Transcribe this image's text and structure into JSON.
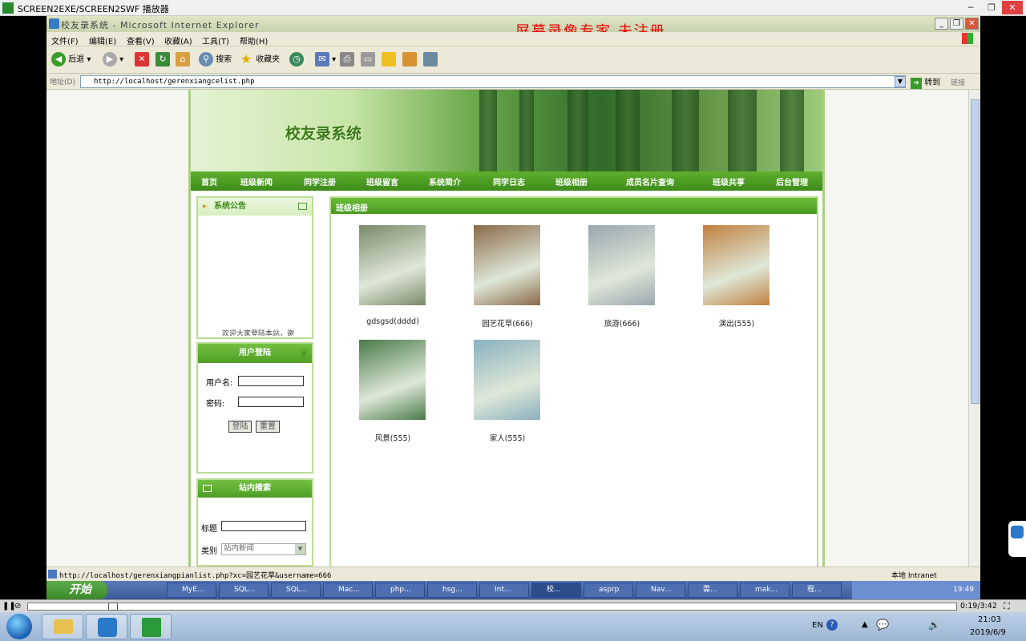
{
  "player": {
    "title": "SCREEN2EXE/SCREEN2SWF 播放器",
    "time": "0:19/3:42"
  },
  "browser": {
    "title": "校友录系统 - Microsoft Internet Explorer",
    "watermark": "屏幕录像专家  未注册",
    "menu": [
      "文件(F)",
      "编辑(E)",
      "查看(V)",
      "收藏(A)",
      "工具(T)",
      "帮助(H)"
    ],
    "toolbar": {
      "back": "后退",
      "search": "搜索",
      "favorites": "收藏夹"
    },
    "address_label": "地址(D)",
    "url": "http://localhost/gerenxiangcelist.php",
    "go": "转到",
    "links": "链接",
    "status_url": "http://localhost/gerenxiangpianlist.php?xc=园艺花草&username=666",
    "zone": "本地 Intranet"
  },
  "site": {
    "title": "校友录系统",
    "nav": [
      "首页",
      "班级新闻",
      "同学注册",
      "班级留言",
      "系统简介",
      "同学日志",
      "班级相册",
      "成员名片查询",
      "班级共享",
      "后台管理"
    ],
    "notice": {
      "title": "系统公告",
      "marquee": "欢迎大家登陆本站，谢"
    },
    "login": {
      "title": "用户登陆",
      "username_label": "用户名:",
      "password_label": "密码:",
      "login_btn": "登陆",
      "reset_btn": "重置"
    },
    "search": {
      "title": "站内搜索",
      "title_label": "标题",
      "category_label": "类别",
      "category_value": "站内新闻"
    },
    "album": {
      "title": "班级相册",
      "items": [
        {
          "caption": "gdsgsd(dddd)",
          "color": "#7a8a6a"
        },
        {
          "caption": "园艺花草(666)",
          "color": "#8a6a4a"
        },
        {
          "caption": "旅游(666)",
          "color": "#9aa6b0"
        },
        {
          "caption": "演出(555)",
          "color": "#c08040"
        },
        {
          "caption": "风景(555)",
          "color": "#4a7a4a"
        },
        {
          "caption": "家人(555)",
          "color": "#8ab0c0"
        }
      ]
    }
  },
  "taskbar": {
    "start": "开始",
    "tasks": [
      "MyE...",
      "SQL...",
      "SQL...",
      "Mac...",
      "php...",
      "hsg...",
      "Int...",
      "校...",
      "asprp",
      "Nav...",
      "需...",
      "mak...",
      "程..."
    ],
    "clock": "19:49"
  },
  "win7": {
    "lang": "EN",
    "time": "21:03",
    "date": "2019/6/9"
  }
}
